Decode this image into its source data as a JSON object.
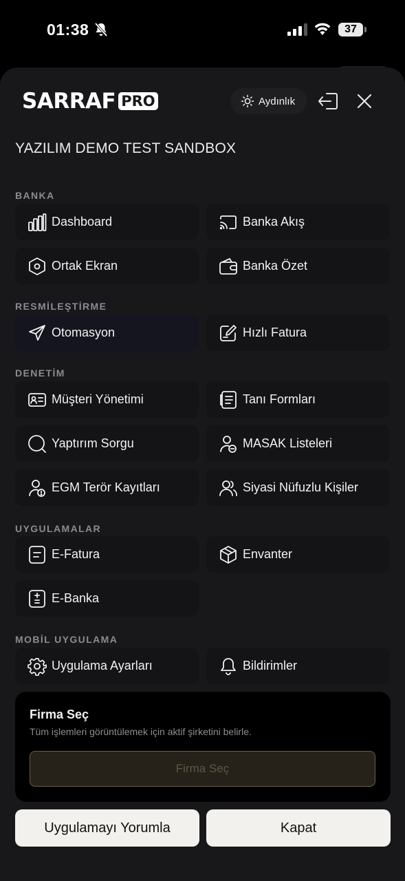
{
  "status_bar": {
    "time": "01:38",
    "battery": "37"
  },
  "header": {
    "logo_word": "SARRAF",
    "logo_badge": "PRO",
    "theme_label": "Aydınlık",
    "company_name": "YAZILIM DEMO TEST SANDBOX"
  },
  "sections": {
    "banka": "BANKA",
    "resmilestirme": "RESMİLEŞTİRME",
    "denetim": "DENETİM",
    "uygulamalar": "UYGULAMALAR",
    "mobil": "MOBİL UYGULAMA"
  },
  "menu": {
    "dashboard": "Dashboard",
    "banka_akis": "Banka Akış",
    "ortak_ekran": "Ortak Ekran",
    "banka_ozet": "Banka Özet",
    "otomasyon": "Otomasyon",
    "hizli_fatura": "Hızlı Fatura",
    "musteri_yonetimi": "Müşteri Yönetimi",
    "tani_formlari": "Tanı Formları",
    "yaptirim_sorgu": "Yaptırım Sorgu",
    "masak_listeleri": "MASAK Listeleri",
    "egm_teror": "EGM Terör Kayıtları",
    "siyasi_nufuzlu": "Siyasi Nüfuzlu Kişiler",
    "e_fatura": "E-Fatura",
    "envanter": "Envanter",
    "e_banka": "E-Banka",
    "uygulama_ayarlari": "Uygulama Ayarları",
    "bildirimler": "Bildirimler"
  },
  "icons": {
    "dashboard": "bar-chart-icon",
    "banka_akis": "cast-icon",
    "ortak_ekran": "hexagon-icon",
    "banka_ozet": "wallet-icon",
    "otomasyon": "send-icon",
    "hizli_fatura": "edit-document-icon",
    "musteri_yonetimi": "id-card-icon",
    "tani_formlari": "form-list-icon",
    "yaptirim_sorgu": "search-icon",
    "masak_listeleri": "user-list-icon",
    "egm_teror": "user-alert-icon",
    "siyasi_nufuzlu": "users-icon",
    "e_fatura": "invoice-icon",
    "envanter": "box-icon",
    "e_banka": "calculator-icon",
    "uygulama_ayarlari": "gear-icon",
    "bildirimler": "bell-icon"
  },
  "firm": {
    "title": "Firma Seç",
    "description": "Tüm işlemleri görüntülemek için aktif şirketini belirle.",
    "button": "Firma Seç"
  },
  "footer": {
    "rate_app": "Uygulamayı Yorumla",
    "close": "Kapat"
  },
  "colors": {
    "background": "#000000",
    "sheet": "#18181b",
    "tile": "#141416",
    "active_tile": "#15151f",
    "firm_button_border": "#6a5f43",
    "footer_button": "#f3f1ed"
  }
}
